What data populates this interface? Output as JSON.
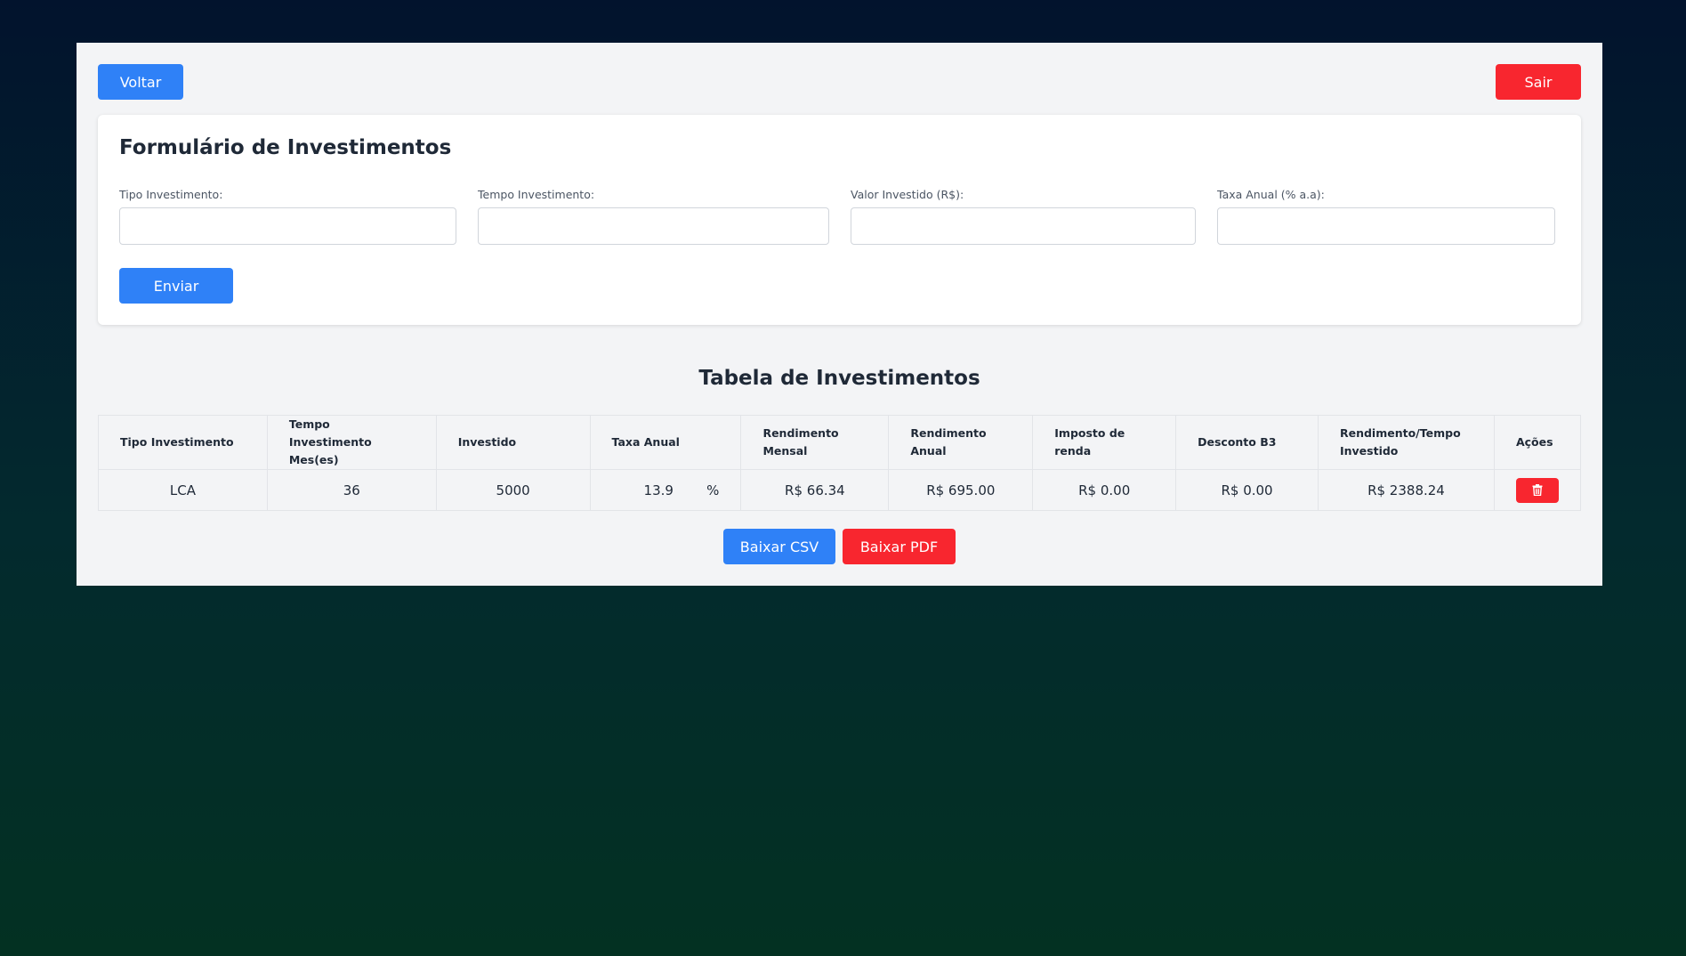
{
  "nav": {
    "back_label": "Voltar",
    "logout_label": "Sair"
  },
  "form": {
    "title": "Formulário de Investimentos",
    "fields": [
      {
        "label": "Tipo Investimento:",
        "value": "",
        "placeholder": ""
      },
      {
        "label": "Tempo Investimento:",
        "value": "",
        "placeholder": ""
      },
      {
        "label": "Valor Investido (R$):",
        "value": "",
        "placeholder": ""
      },
      {
        "label": "Taxa Anual (% a.a):",
        "value": "",
        "placeholder": ""
      }
    ],
    "submit_label": "Enviar"
  },
  "table": {
    "title": "Tabela de Investimentos",
    "headers": [
      "Tipo Investimento",
      "Tempo Investimento Mes(es)",
      "Investido",
      "Taxa Anual",
      "Rendimento Mensal",
      "Rendimento Anual",
      "Imposto de renda",
      "Desconto B3",
      "Rendimento/Tempo Investido",
      "Ações"
    ],
    "rows": [
      {
        "tipo": "LCA",
        "tempo": "36",
        "investido": "5000",
        "taxa": "13.9",
        "taxa_unit": "%",
        "rend_mensal": "R$ 66.34",
        "rend_anual": "R$ 695.00",
        "imposto": "R$ 0.00",
        "desconto_b3": "R$ 0.00",
        "rend_tempo": "R$ 2388.24",
        "action_icon": "trash-icon"
      }
    ]
  },
  "export": {
    "csv_label": "Baixar CSV",
    "pdf_label": "Baixar PDF"
  },
  "colors": {
    "primary": "#2f81f7",
    "danger": "#f8262f",
    "panel_bg": "#f3f4f6"
  }
}
